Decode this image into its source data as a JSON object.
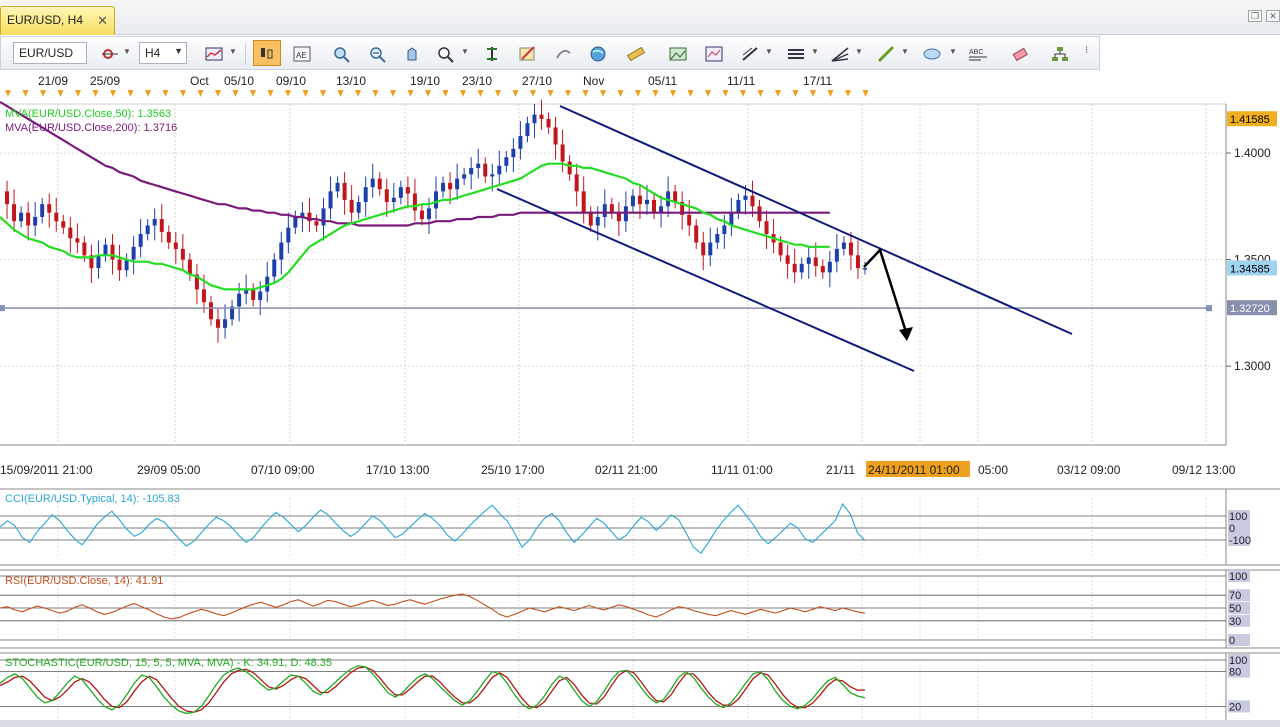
{
  "tab": {
    "label": "EUR/USD, H4"
  },
  "toolbar": {
    "symbol": "EUR/USD",
    "timeframe": "H4"
  },
  "colors": {
    "mva50": "#22dd22",
    "mva200": "#7a1a7a",
    "up_candle": "#1c3fa8",
    "down_candle": "#c0161c",
    "channel": "#101a7a",
    "cci": "#2aa6d4",
    "rsi": "#c0501c",
    "stoch_k": "#22aa22",
    "stoch_d": "#b01818",
    "price_tag_current": "#9fd3f0",
    "price_tag_high": "#f0b020",
    "date_highlight": "#f0a020"
  },
  "chart_data": [
    {
      "type": "candlestick",
      "symbol": "EUR/USD",
      "timeframe": "H4",
      "ylim": [
        1.263,
        1.423
      ],
      "y_ticks": [
        "1.3000",
        "1.3500",
        "1.4000"
      ],
      "top_date_labels": [
        "21/09",
        "25/09",
        "Oct",
        "05/10",
        "09/10",
        "13/10",
        "19/10",
        "23/10",
        "27/10",
        "Nov",
        "05/11",
        "11/11",
        "17/11"
      ],
      "bottom_date_labels": [
        "15/09/2011 21:00",
        "29/09 05:00",
        "07/10 09:00",
        "17/10 13:00",
        "25/10 17:00",
        "02/11 21:00",
        "11/11 01:00",
        "21/11",
        "05:00",
        "03/12 09:00",
        "09/12 13:00"
      ],
      "highlighted_date": "24/11/2011 01:00",
      "price_tags": {
        "high": "1.41585",
        "current": "1.34585",
        "hline": "1.32720"
      },
      "hline_value": 1.3272,
      "mva50_label": "MVA(EUR/USD.Close,50): 1.3563",
      "mva200_label": "MVA(EUR/USD.Close,200): 1.3716",
      "close_series": [
        1.382,
        1.376,
        1.368,
        1.372,
        1.366,
        1.37,
        1.376,
        1.372,
        1.368,
        1.365,
        1.36,
        1.358,
        1.352,
        1.346,
        1.352,
        1.357,
        1.35,
        1.345,
        1.35,
        1.356,
        1.362,
        1.366,
        1.369,
        1.363,
        1.358,
        1.355,
        1.35,
        1.343,
        1.336,
        1.33,
        1.322,
        1.318,
        1.322,
        1.328,
        1.334,
        1.336,
        1.331,
        1.335,
        1.342,
        1.35,
        1.358,
        1.365,
        1.37,
        1.372,
        1.368,
        1.366,
        1.374,
        1.382,
        1.386,
        1.378,
        1.372,
        1.377,
        1.384,
        1.388,
        1.383,
        1.377,
        1.379,
        1.384,
        1.381,
        1.373,
        1.369,
        1.374,
        1.382,
        1.386,
        1.383,
        1.388,
        1.39,
        1.393,
        1.395,
        1.389,
        1.39,
        1.394,
        1.398,
        1.402,
        1.408,
        1.414,
        1.418,
        1.416,
        1.412,
        1.404,
        1.396,
        1.39,
        1.382,
        1.372,
        1.366,
        1.37,
        1.376,
        1.372,
        1.368,
        1.375,
        1.38,
        1.376,
        1.378,
        1.372,
        1.375,
        1.382,
        1.377,
        1.371,
        1.366,
        1.358,
        1.352,
        1.358,
        1.362,
        1.366,
        1.372,
        1.378,
        1.38,
        1.375,
        1.368,
        1.362,
        1.358,
        1.352,
        1.348,
        1.344,
        1.348,
        1.351,
        1.347,
        1.344,
        1.349,
        1.355,
        1.358,
        1.352,
        1.346,
        1.346
      ],
      "mva50": [
        1.37,
        1.367,
        1.364,
        1.362,
        1.36,
        1.359,
        1.358,
        1.356,
        1.355,
        1.354,
        1.352,
        1.351,
        1.351,
        1.351,
        1.352,
        1.352,
        1.352,
        1.351,
        1.35,
        1.349,
        1.349,
        1.349,
        1.348,
        1.348,
        1.347,
        1.346,
        1.345,
        1.343,
        1.342,
        1.34,
        1.338,
        1.337,
        1.336,
        1.336,
        1.336,
        1.336,
        1.336,
        1.337,
        1.338,
        1.339,
        1.341,
        1.344,
        1.348,
        1.352,
        1.356,
        1.358,
        1.36,
        1.362,
        1.364,
        1.366,
        1.367,
        1.368,
        1.369,
        1.37,
        1.371,
        1.372,
        1.373,
        1.374,
        1.375,
        1.375,
        1.376,
        1.376,
        1.377,
        1.378,
        1.378,
        1.379,
        1.38,
        1.381,
        1.382,
        1.383,
        1.384,
        1.385,
        1.386,
        1.387,
        1.388,
        1.39,
        1.392,
        1.394,
        1.395,
        1.395,
        1.395,
        1.394,
        1.394,
        1.393,
        1.393,
        1.392,
        1.391,
        1.39,
        1.389,
        1.388,
        1.386,
        1.385,
        1.383,
        1.381,
        1.379,
        1.378,
        1.377,
        1.376,
        1.375,
        1.374,
        1.372,
        1.371,
        1.369,
        1.368,
        1.366,
        1.365,
        1.364,
        1.363,
        1.362,
        1.361,
        1.36,
        1.359,
        1.358,
        1.357,
        1.357,
        1.356,
        1.356,
        1.356,
        1.356
      ],
      "mva200": [
        1.424,
        1.422,
        1.42,
        1.418,
        1.416,
        1.414,
        1.412,
        1.41,
        1.408,
        1.406,
        1.404,
        1.402,
        1.4,
        1.398,
        1.396,
        1.394,
        1.393,
        1.391,
        1.39,
        1.389,
        1.387,
        1.386,
        1.385,
        1.384,
        1.383,
        1.382,
        1.381,
        1.38,
        1.379,
        1.378,
        1.377,
        1.376,
        1.376,
        1.375,
        1.374,
        1.374,
        1.373,
        1.373,
        1.372,
        1.372,
        1.371,
        1.371,
        1.37,
        1.37,
        1.369,
        1.369,
        1.368,
        1.368,
        1.367,
        1.367,
        1.367,
        1.366,
        1.366,
        1.366,
        1.366,
        1.366,
        1.366,
        1.366,
        1.366,
        1.367,
        1.367,
        1.367,
        1.368,
        1.368,
        1.368,
        1.369,
        1.369,
        1.369,
        1.37,
        1.37,
        1.37,
        1.371,
        1.371,
        1.371,
        1.372,
        1.372,
        1.372,
        1.372,
        1.372,
        1.372,
        1.372,
        1.372,
        1.372,
        1.372,
        1.372,
        1.372,
        1.372,
        1.372,
        1.372,
        1.372,
        1.372,
        1.372,
        1.372,
        1.372,
        1.372,
        1.372,
        1.372,
        1.372,
        1.372,
        1.372,
        1.372,
        1.372,
        1.372,
        1.372,
        1.372,
        1.372,
        1.372,
        1.372,
        1.372,
        1.372,
        1.372,
        1.372,
        1.372,
        1.372,
        1.372,
        1.372,
        1.372,
        1.372,
        1.372
      ]
    },
    {
      "type": "line",
      "label": "CCI(EUR/USD.Typical, 14): -105.83",
      "ylim": [
        -250,
        250
      ],
      "levels": [
        "100",
        "0",
        "-100"
      ],
      "values": [
        10,
        60,
        20,
        -80,
        -120,
        -30,
        40,
        110,
        60,
        -20,
        -90,
        -140,
        -60,
        30,
        90,
        140,
        70,
        -10,
        -70,
        -40,
        30,
        80,
        50,
        -20,
        -90,
        -150,
        -110,
        -40,
        30,
        90,
        60,
        10,
        -60,
        -120,
        -80,
        0,
        70,
        130,
        90,
        30,
        -30,
        20,
        90,
        150,
        110,
        40,
        -20,
        -70,
        -30,
        40,
        100,
        60,
        -10,
        -80,
        -50,
        10,
        70,
        120,
        80,
        20,
        -60,
        -110,
        -50,
        20,
        80,
        140,
        190,
        120,
        60,
        -40,
        -160,
        -100,
        0,
        80,
        120,
        60,
        -40,
        -120,
        -60,
        10,
        80,
        40,
        -30,
        -100,
        -60,
        20,
        90,
        50,
        -20,
        40,
        110,
        70,
        -40,
        -160,
        -210,
        -120,
        -20,
        60,
        130,
        190,
        110,
        30,
        -70,
        -130,
        -80,
        -20,
        40,
        0,
        -90,
        -120,
        -60,
        0,
        60,
        200,
        120,
        -40,
        -105.83
      ]
    },
    {
      "type": "line",
      "label": "RSI(EUR/USD.Close, 14): 41.91",
      "ylim": [
        0,
        100
      ],
      "levels": [
        "100",
        "70",
        "50",
        "30",
        "0"
      ],
      "values": [
        50,
        52,
        47,
        44,
        49,
        53,
        50,
        46,
        42,
        45,
        51,
        55,
        50,
        44,
        40,
        43,
        48,
        53,
        57,
        52,
        47,
        41,
        36,
        33,
        35,
        40,
        44,
        48,
        45,
        41,
        38,
        42,
        47,
        52,
        56,
        59,
        55,
        51,
        55,
        60,
        63,
        58,
        53,
        57,
        62,
        60,
        56,
        52,
        55,
        59,
        62,
        58,
        54,
        56,
        60,
        63,
        59,
        56,
        60,
        64,
        67,
        70,
        72,
        68,
        62,
        55,
        48,
        40,
        36,
        40,
        45,
        50,
        47,
        44,
        48,
        52,
        49,
        46,
        50,
        54,
        50,
        47,
        51,
        55,
        52,
        48,
        44,
        39,
        36,
        41,
        47,
        52,
        50,
        46,
        43,
        40,
        38,
        42,
        46,
        43,
        40,
        44,
        48,
        45,
        42,
        46,
        50,
        47,
        44,
        48,
        52,
        49,
        46,
        50,
        47,
        44,
        41.91
      ]
    },
    {
      "type": "line",
      "label": "STOCHASTIC(EUR/USD, 15, 5, 5, MVA, MVA) - K: 34.91, D: 48.35",
      "ylim": [
        0,
        100
      ],
      "levels": [
        "100",
        "80",
        "20"
      ],
      "series": [
        {
          "name": "K",
          "values": [
            60,
            70,
            76,
            68,
            52,
            36,
            26,
            30,
            44,
            60,
            72,
            66,
            50,
            34,
            20,
            14,
            22,
            40,
            60,
            74,
            70,
            54,
            36,
            22,
            12,
            8,
            10,
            20,
            38,
            58,
            74,
            82,
            86,
            80,
            70,
            58,
            48,
            52,
            64,
            74,
            72,
            60,
            46,
            40,
            50,
            62,
            74,
            84,
            90,
            88,
            76,
            60,
            44,
            36,
            44,
            58,
            70,
            76,
            68,
            54,
            42,
            30,
            22,
            30,
            46,
            64,
            80,
            76,
            60,
            40,
            24,
            16,
            22,
            38,
            58,
            72,
            66,
            48,
            30,
            20,
            28,
            46,
            66,
            80,
            82,
            70,
            52,
            36,
            26,
            32,
            50,
            70,
            80,
            70,
            52,
            36,
            24,
            18,
            26,
            42,
            60,
            76,
            80,
            66,
            46,
            30,
            20,
            16,
            22,
            34,
            50,
            64,
            70,
            58,
            44,
            38,
            34.91
          ]
        },
        {
          "name": "D",
          "values": [
            56,
            62,
            70,
            72,
            64,
            50,
            36,
            30,
            36,
            48,
            62,
            68,
            62,
            48,
            32,
            20,
            18,
            28,
            46,
            62,
            72,
            66,
            50,
            34,
            20,
            12,
            10,
            14,
            26,
            44,
            62,
            76,
            82,
            84,
            78,
            66,
            54,
            50,
            56,
            66,
            72,
            68,
            56,
            44,
            44,
            54,
            66,
            78,
            86,
            88,
            82,
            68,
            52,
            40,
            40,
            50,
            62,
            72,
            72,
            62,
            48,
            36,
            26,
            26,
            36,
            52,
            70,
            78,
            70,
            52,
            34,
            20,
            18,
            28,
            46,
            64,
            70,
            58,
            40,
            26,
            24,
            36,
            56,
            74,
            82,
            78,
            62,
            44,
            30,
            28,
            40,
            60,
            76,
            76,
            62,
            44,
            30,
            22,
            22,
            32,
            50,
            68,
            78,
            74,
            58,
            40,
            26,
            18,
            18,
            26,
            40,
            56,
            66,
            64,
            54,
            48,
            48.35
          ]
        }
      ]
    }
  ]
}
